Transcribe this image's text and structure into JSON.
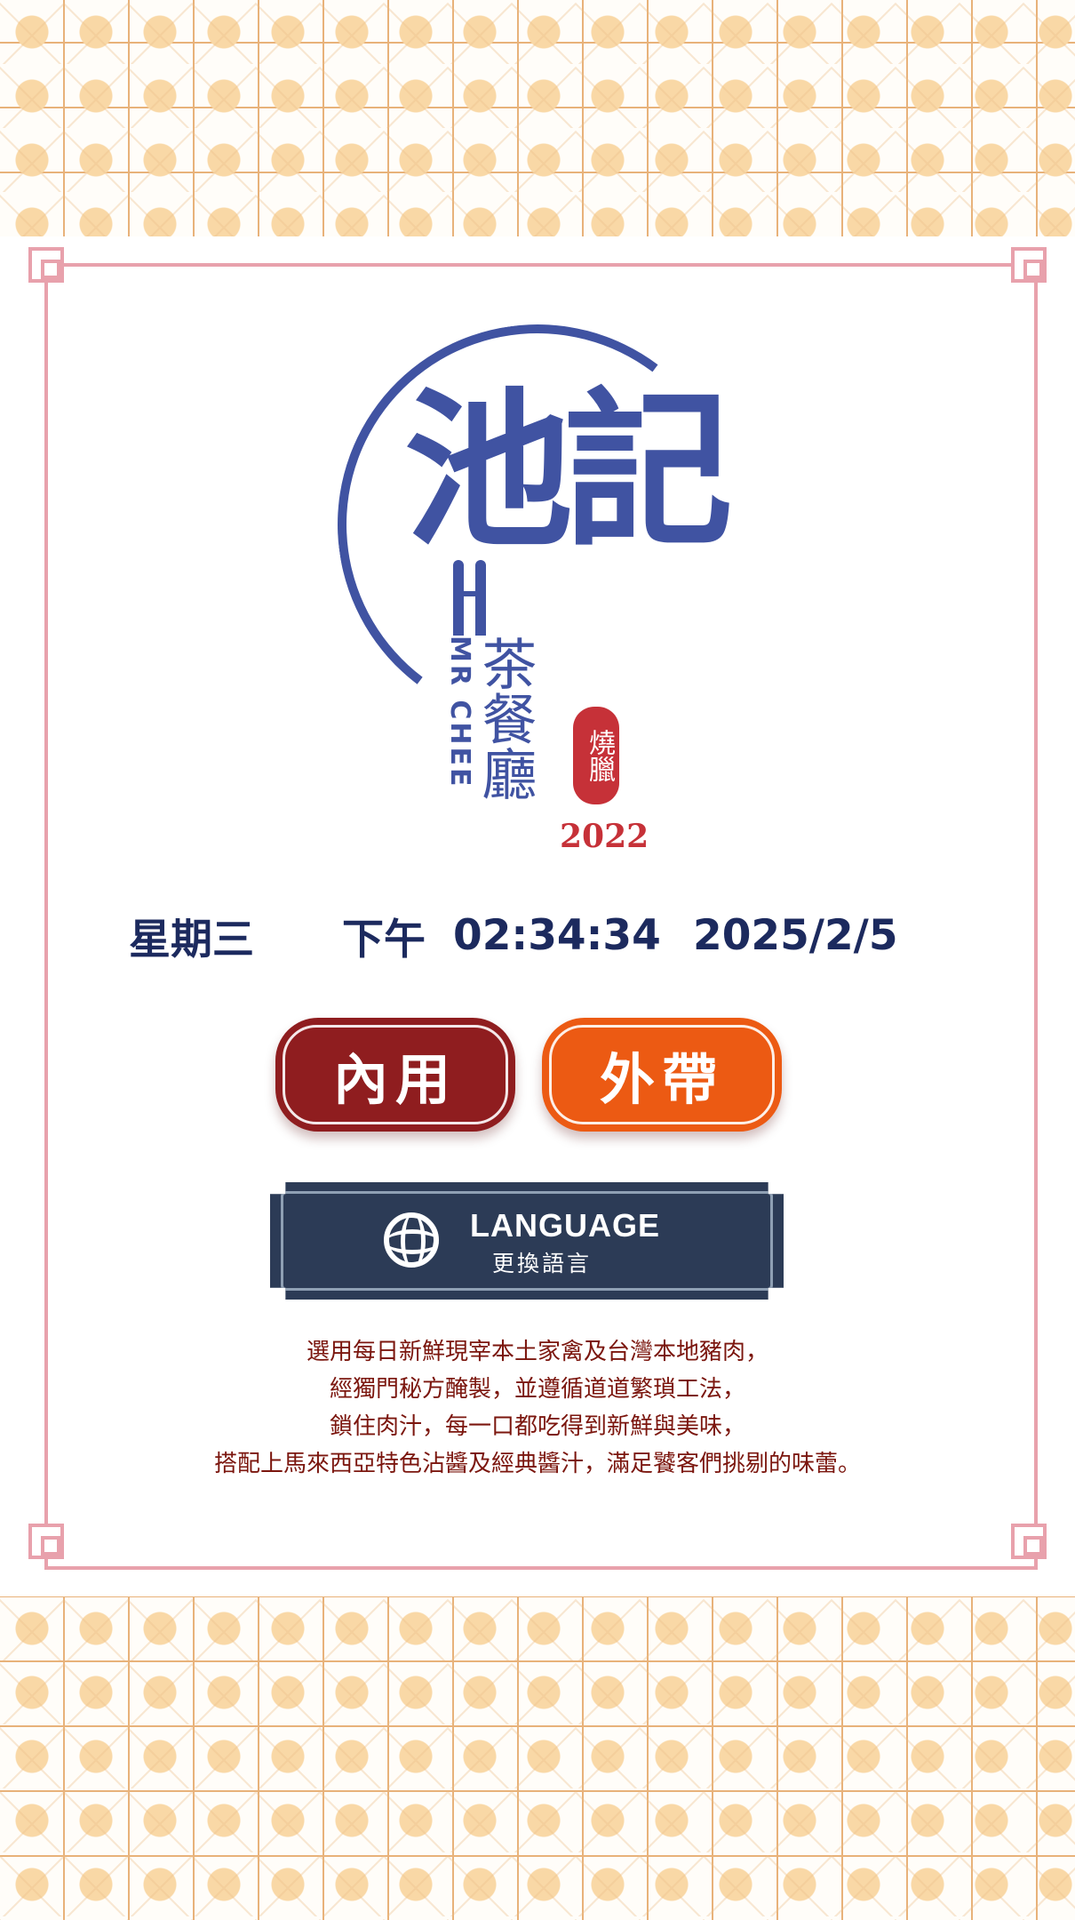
{
  "logo": {
    "main_text": "池記",
    "subtitle_cn": "茶餐廳",
    "english_name": "MR CHEE",
    "seal_text": "燒臘",
    "year": "2022"
  },
  "clock": {
    "weekday": "星期三",
    "ampm": "下午",
    "time": "02:34:34",
    "date": "2025/2/5"
  },
  "buttons": {
    "dine_in": "內用",
    "take_out": "外帶"
  },
  "language": {
    "title": "LANGUAGE",
    "subtitle": "更換語言"
  },
  "description": [
    "選用每日新鮮現宰本土家禽及台灣本地豬肉，",
    "經獨門秘方醃製，並遵循道道繁瑣工法，",
    "鎖住肉汁，每一口都吃得到新鮮與美味，",
    "搭配上馬來西亞特色沾醬及經典醬汁，滿足饕客們挑剔的味蕾。"
  ],
  "colors": {
    "brand_blue": "#4053a2",
    "dine_in_red": "#8f1d1f",
    "take_out_orange": "#ec5a13",
    "language_navy": "#2c3b56",
    "frame_pink": "#e8a1ac"
  }
}
